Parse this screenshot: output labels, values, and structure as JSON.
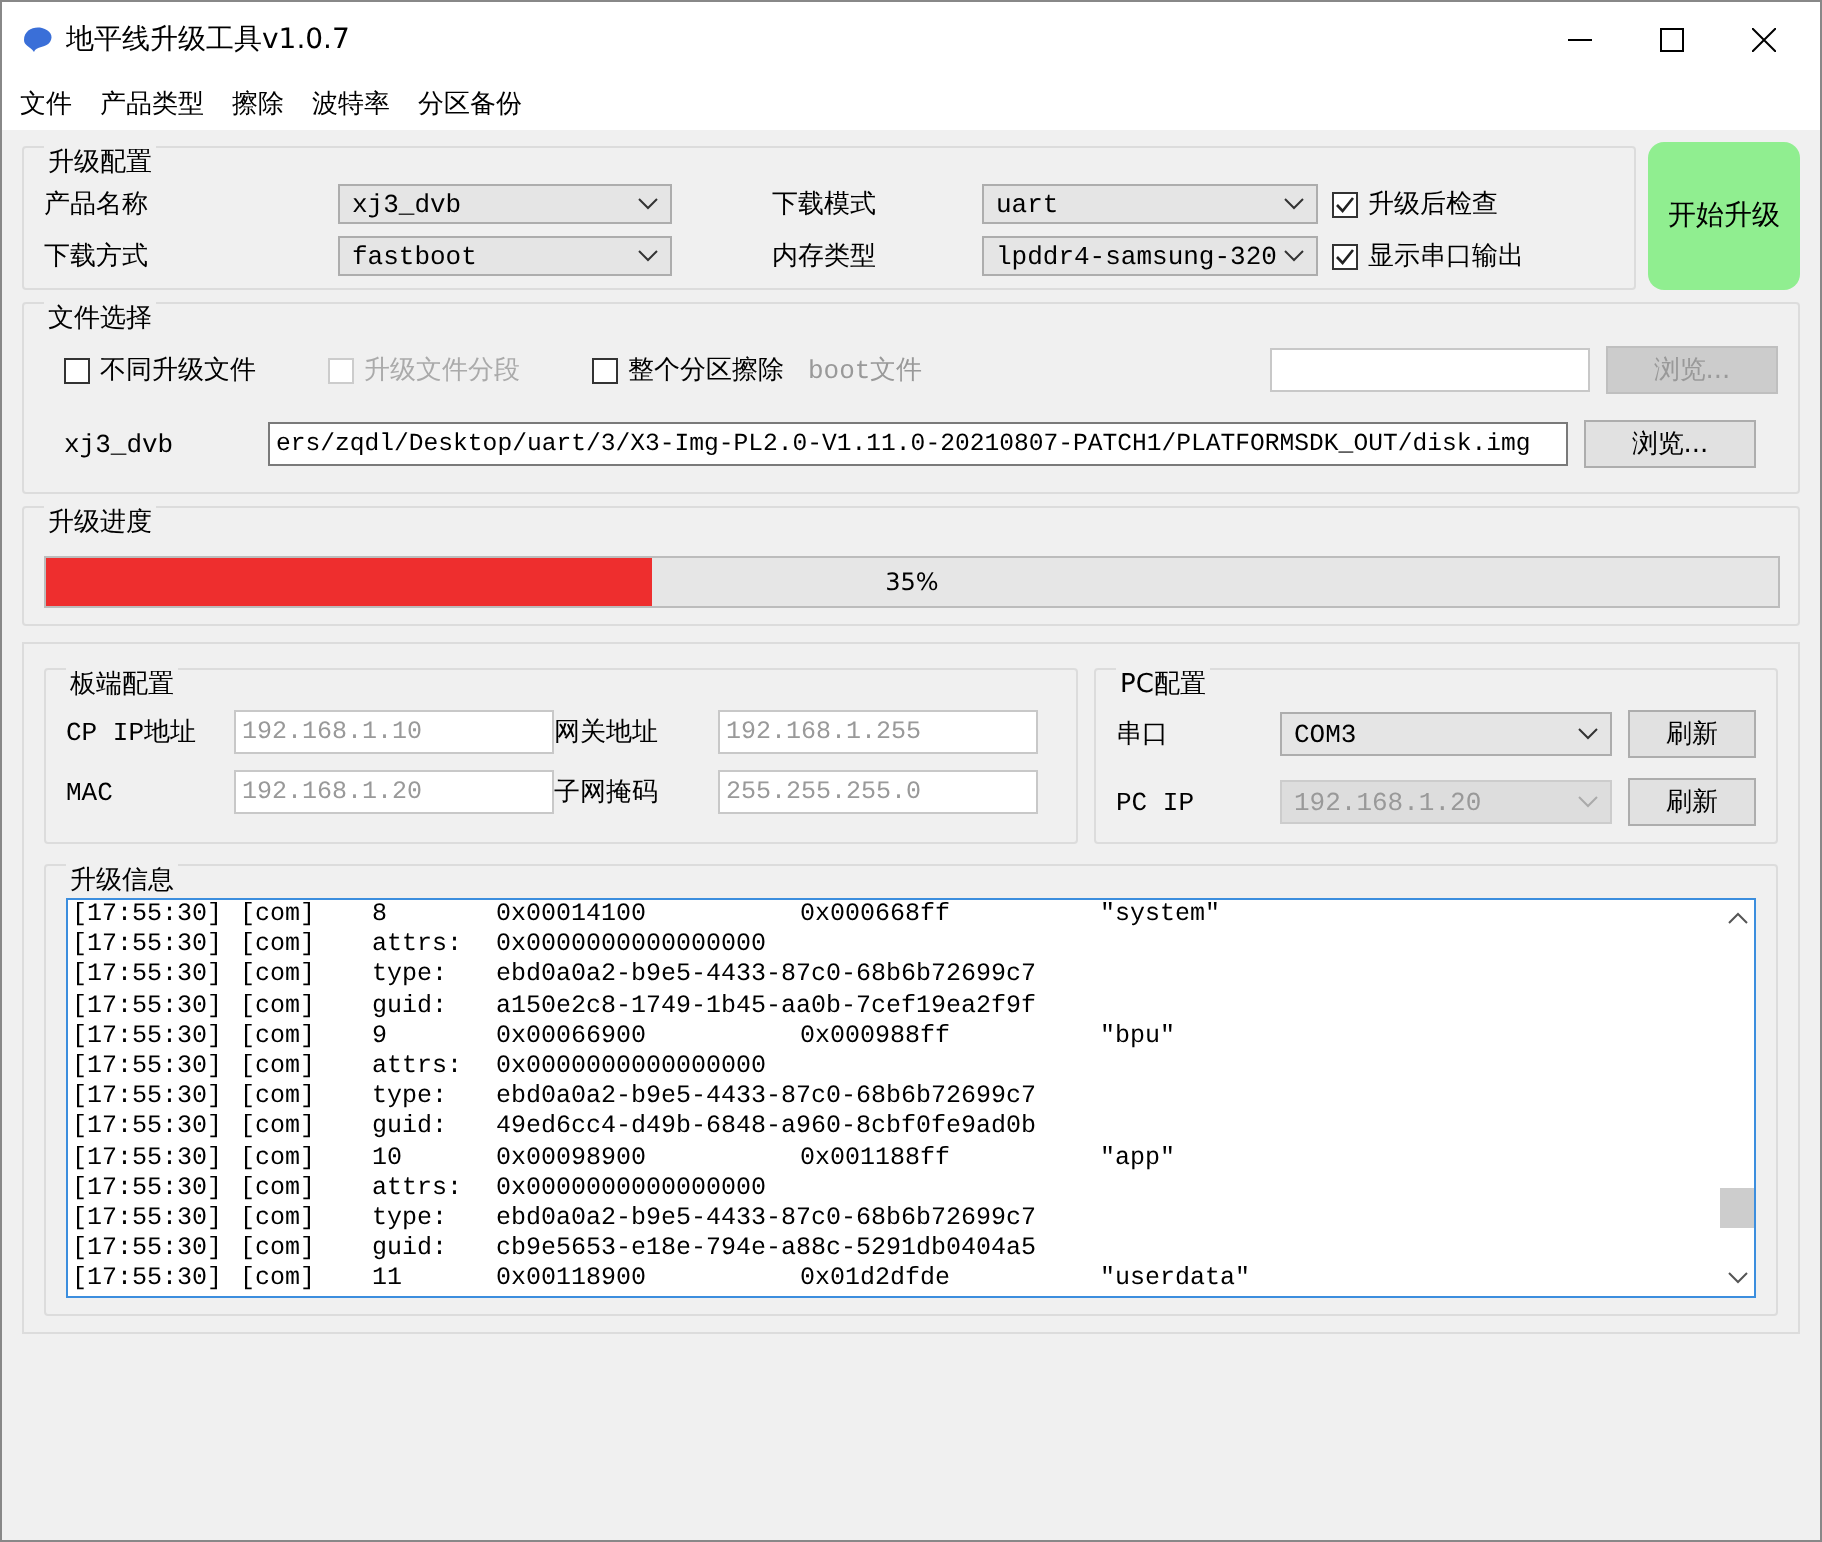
{
  "window": {
    "title": "地平线升级工具v1.0.7"
  },
  "menu": [
    "文件",
    "产品类型",
    "擦除",
    "波特率",
    "分区备份"
  ],
  "upgrade_config": {
    "title": "升级配置",
    "rows": [
      [
        {
          "label": "产品名称",
          "value": "xj3_dvb"
        },
        {
          "label": "下载模式",
          "value": "uart"
        },
        {
          "label": "升级后检查",
          "checked": true
        }
      ],
      [
        {
          "label": "下载方式",
          "value": "fastboot"
        },
        {
          "label": "内存类型",
          "value": "lpddr4-samsung-320"
        },
        {
          "label": "显示串口输出",
          "checked": true
        }
      ]
    ]
  },
  "start_button": "开始升级",
  "file_select": {
    "title": "文件选择",
    "options": [
      {
        "label": "不同升级文件",
        "checked": false,
        "disabled": false
      },
      {
        "label": "升级文件分段",
        "checked": false,
        "disabled": true
      },
      {
        "label": "整个分区擦除",
        "checked": false,
        "disabled": false
      }
    ],
    "boot": {
      "label": "boot文件",
      "button": "浏览...",
      "disabled": true
    },
    "path": {
      "label": "xj3_dvb",
      "value": "ers/zqdl/Desktop/uart/3/X3-Img-PL2.0-V1.11.0-20210807-PATCH1/PLATFORMSDK_OUT/disk.img",
      "button": "浏览...",
      "disabled": false
    }
  },
  "progress": {
    "title": "升级进度",
    "level": 0.35,
    "text": "35%"
  },
  "board_config": {
    "title": "板端配置",
    "fields": [
      {
        "label": "CP IP地址",
        "placeholder": "192.168.1.10"
      },
      {
        "label": "网关地址",
        "placeholder": "192.168.1.255"
      },
      {
        "label": "MAC",
        "placeholder": "192.168.1.20"
      },
      {
        "label": "子网掩码",
        "placeholder": "255.255.255.0"
      }
    ]
  },
  "pc_config": {
    "title": "PC配置",
    "rows": [
      {
        "label": "串口",
        "value": "COM3",
        "disabled": false,
        "button": "刷新"
      },
      {
        "label": "PC IP",
        "value": "192.168.1.20",
        "disabled": true,
        "button": "刷新"
      }
    ]
  },
  "log": {
    "title": "升级信息",
    "lines": [
      {
        "time": "[17:55:30]",
        "source": "[com]",
        "field": "8",
        "value": "0x00014100",
        "end": "0x000668ff",
        "name": "\"system\""
      },
      {
        "time": "[17:55:30]",
        "source": "[com]",
        "field": "attrs:",
        "value": "0x0000000000000000"
      },
      {
        "time": "[17:55:30]",
        "source": "[com]",
        "field": "type:",
        "value": "ebd0a0a2-b9e5-4433-87c0-68b6b72699c7"
      },
      {
        "time": "[17:55:30]",
        "source": "[com]",
        "field": "guid:",
        "value": "a150e2c8-1749-1b45-aa0b-7cef19ea2f9f"
      },
      {
        "time": "[17:55:30]",
        "source": "[com]",
        "field": "9",
        "value": "0x00066900",
        "end": "0x000988ff",
        "name": "\"bpu\""
      },
      {
        "time": "[17:55:30]",
        "source": "[com]",
        "field": "attrs:",
        "value": "0x0000000000000000"
      },
      {
        "time": "[17:55:30]",
        "source": "[com]",
        "field": "type:",
        "value": "ebd0a0a2-b9e5-4433-87c0-68b6b72699c7"
      },
      {
        "time": "[17:55:30]",
        "source": "[com]",
        "field": "guid:",
        "value": "49ed6cc4-d49b-6848-a960-8cbf0fe9ad0b"
      },
      {
        "time": "[17:55:30]",
        "source": "[com]",
        "field": "10",
        "value": "0x00098900",
        "end": "0x001188ff",
        "name": "\"app\""
      },
      {
        "time": "[17:55:30]",
        "source": "[com]",
        "field": "attrs:",
        "value": "0x0000000000000000"
      },
      {
        "time": "[17:55:30]",
        "source": "[com]",
        "field": "type:",
        "value": "ebd0a0a2-b9e5-4433-87c0-68b6b72699c7"
      },
      {
        "time": "[17:55:30]",
        "source": "[com]",
        "field": "guid:",
        "value": "cb9e5653-e18e-794e-a88c-5291db0404a5"
      },
      {
        "time": "[17:55:30]",
        "source": "[com]",
        "field": "11",
        "value": "0x00118900",
        "end": "0x01d2dfde",
        "name": "\"userdata\""
      }
    ]
  }
}
